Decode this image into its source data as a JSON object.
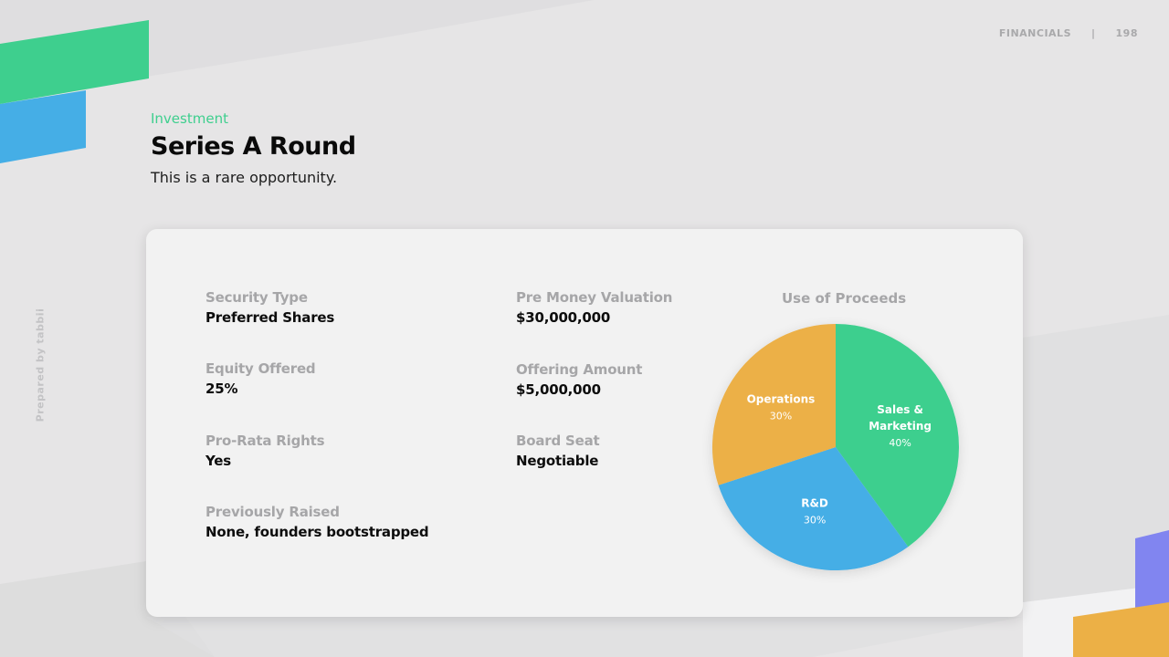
{
  "header": {
    "section": "FINANCIALS",
    "separator": "|",
    "page_number": "198"
  },
  "side_credit": "Prepared by tabbii",
  "slide": {
    "eyebrow": "Investment",
    "title": "Series A Round",
    "subtitle": "This is a rare opportunity."
  },
  "facts": [
    {
      "label": "Security Type",
      "value": "Preferred Shares"
    },
    {
      "label": "Equity Offered",
      "value": "25%"
    },
    {
      "label": "Pro-Rata Rights",
      "value": "Yes"
    },
    {
      "label": "Previously Raised",
      "value": "None, founders bootstrapped"
    },
    {
      "label": "Pre Money Valuation",
      "value": "$30,000,000"
    },
    {
      "label": "Offering Amount",
      "value": "$5,000,000"
    },
    {
      "label": "Board Seat",
      "value": "Negotiable"
    }
  ],
  "colors": {
    "green": "#3ecf8e",
    "blue": "#45aee6",
    "orange": "#ecb046",
    "purple": "#8185f0"
  },
  "chart_data": {
    "type": "pie",
    "title": "Use of Proceeds",
    "slices": [
      {
        "name": "Sales & Marketing",
        "label_lines": [
          "Sales &",
          "Marketing"
        ],
        "value": 40,
        "percent_label": "40%",
        "color": "#3ecf8e"
      },
      {
        "name": "R&D",
        "label_lines": [
          "R&D"
        ],
        "value": 30,
        "percent_label": "30%",
        "color": "#45aee6"
      },
      {
        "name": "Operations",
        "label_lines": [
          "Operations"
        ],
        "value": 30,
        "percent_label": "30%",
        "color": "#ecb046"
      }
    ]
  }
}
